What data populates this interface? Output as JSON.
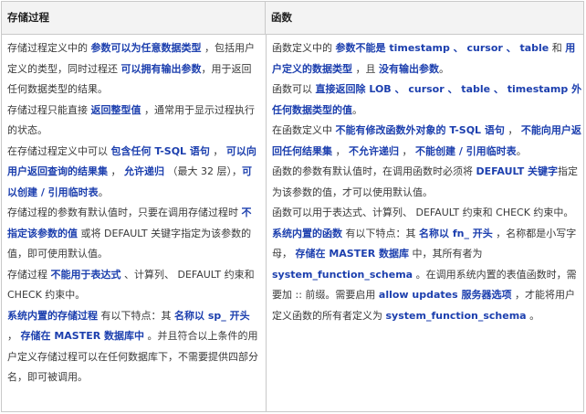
{
  "header": {
    "left": "存储过程",
    "right": "函数"
  },
  "left": [
    [
      [
        "t",
        "存储过程定义中的 "
      ],
      [
        "b",
        "参数可以为任意数据类型"
      ],
      [
        "t",
        " ，包括用户定义的类型，同时过程还 "
      ],
      [
        "b",
        "可以拥有输出参数"
      ],
      [
        "t",
        "，用于返回任何数据类型的结果。"
      ]
    ],
    [
      [
        "t",
        "存储过程只能直接 "
      ],
      [
        "b",
        "返回整型值"
      ],
      [
        "t",
        " ，通常用于显示过程执行的状态。"
      ]
    ],
    [
      [
        "t",
        "在存储过程定义中可以 "
      ],
      [
        "b",
        "包含任何 T-SQL 语句"
      ],
      [
        "t",
        " ， "
      ],
      [
        "b",
        "可以向用户返回查询的结果集"
      ],
      [
        "t",
        " ， "
      ],
      [
        "b",
        "允许递归"
      ],
      [
        "t",
        " （最大 32 层），"
      ],
      [
        "b",
        "可以创建 / 引用临时表"
      ],
      [
        "t",
        "。"
      ]
    ],
    [
      [
        "t",
        "存储过程的参数有默认值时，只要在调用存储过程时 "
      ],
      [
        "b",
        "不指定该参数的值"
      ],
      [
        "t",
        " 或将 DEFAULT 关键字指定为该参数的值，即可使用默认值。"
      ]
    ],
    [
      [
        "t",
        "存储过程 "
      ],
      [
        "b",
        "不能用于表达式"
      ],
      [
        "t",
        " 、计算列、 DEFAULT 约束和 CHECK 约束中。"
      ]
    ],
    [
      [
        "b",
        "系统内置的存储过程"
      ],
      [
        "t",
        " 有以下特点：其 "
      ],
      [
        "b",
        "名称以 sp_ 开头"
      ],
      [
        "t",
        " ， "
      ],
      [
        "b",
        "存储在 MASTER 数据库中"
      ],
      [
        "t",
        " 。并且符合以上条件的用户定义存储过程可以在任何数据库下，不需要提供四部分名，即可被调用。"
      ]
    ]
  ],
  "right": [
    [
      [
        "t",
        "函数定义中的 "
      ],
      [
        "b",
        "参数不能是 timestamp 、 cursor 、 table"
      ],
      [
        "t",
        " 和 "
      ],
      [
        "b",
        "用户定义的数据类型"
      ],
      [
        "t",
        " ，且 "
      ],
      [
        "b",
        "没有输出参数"
      ],
      [
        "t",
        "。"
      ]
    ],
    [
      [
        "t",
        "函数可以 "
      ],
      [
        "b",
        "直接返回除 LOB 、 cursor 、 table 、 timestamp 外任何数据类型的值"
      ],
      [
        "t",
        "。"
      ]
    ],
    [
      [
        "t",
        "在函数定义中 "
      ],
      [
        "b",
        "不能有修改函数外对象的 T-SQL 语句"
      ],
      [
        "t",
        " ， "
      ],
      [
        "b",
        "不能向用户返回任何结果集"
      ],
      [
        "t",
        " ， "
      ],
      [
        "b",
        "不允许递归"
      ],
      [
        "t",
        " ， "
      ],
      [
        "b",
        "不能创建 / 引用临时表"
      ],
      [
        "t",
        "。"
      ]
    ],
    [
      [
        "t",
        "函数的参数有默认值时，在调用函数时必须将 "
      ],
      [
        "b",
        "DEFAULT 关键字"
      ],
      [
        "t",
        "指定为该参数的值，才可以使用默认值。"
      ]
    ],
    [
      [
        "t",
        "函数可以用于表达式、计算列、 DEFAULT 约束和 CHECK 约束中。"
      ]
    ],
    [
      [
        "b",
        "系统内置的函数"
      ],
      [
        "t",
        " 有以下特点：其 "
      ],
      [
        "b",
        "名称以 fn_ 开头"
      ],
      [
        "t",
        " ，名称都是小写字母， "
      ],
      [
        "b",
        "存储在 MASTER 数据库"
      ],
      [
        "t",
        " 中，其所有者为 "
      ],
      [
        "b",
        "system_function_schema"
      ],
      [
        "t",
        " 。在调用系统内置的表值函数时，需要加 :: 前缀。需要启用 "
      ],
      [
        "b",
        "allow updates 服务器选项"
      ],
      [
        "t",
        " ，才能将用户定义函数的所有者定义为 "
      ],
      [
        "b",
        "system_function_schema"
      ],
      [
        "t",
        " 。"
      ]
    ]
  ],
  "colors": {
    "highlight": "#1c3fae",
    "text": "#3a3a3a",
    "header_bg": "#f3f3f3",
    "border": "#c9c9c9"
  }
}
